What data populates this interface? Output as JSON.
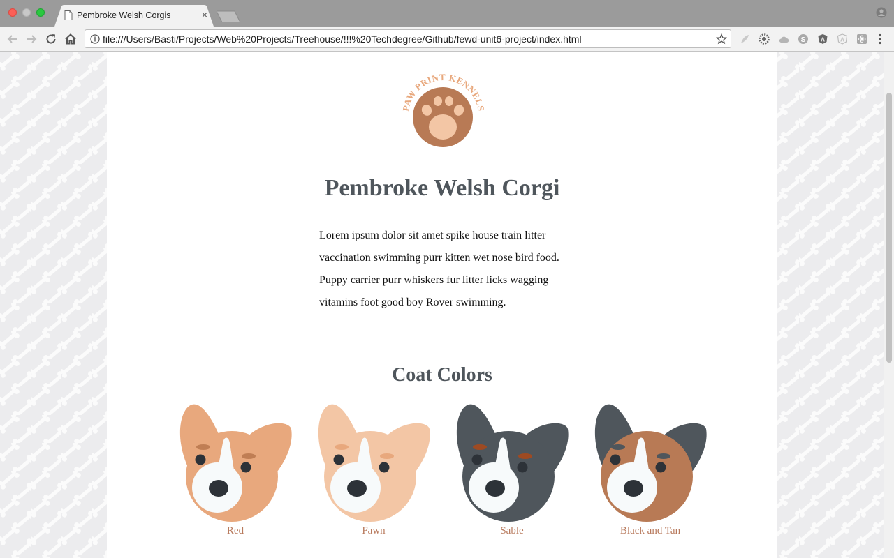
{
  "browser": {
    "tab_title": "Pembroke Welsh Corgis",
    "tab_close": "×",
    "url": "file:///Users/Basti/Projects/Web%20Projects/Treehouse/!!!%20Techdegree/Github/fewd-unit6-project/index.html"
  },
  "page": {
    "logo_text": "PAW PRINT KENNELS",
    "title": "Pembroke Welsh Corgi",
    "intro": "Lorem ipsum dolor sit amet spike house train litter vaccination swimming purr kitten wet nose bird food. Puppy carrier purr whiskers fur litter licks wagging vitamins foot good boy Rover swimming.",
    "coat_colors_heading": "Coat Colors",
    "coat_colors": [
      {
        "label": "Red",
        "primary": "#e8a87d",
        "ear_inner": "#e8a87d",
        "brow": "#c07e54"
      },
      {
        "label": "Fawn",
        "primary": "#f3c6a5",
        "ear_inner": "#f3c6a5",
        "brow": "#e8a87d"
      },
      {
        "label": "Sable",
        "primary": "#4f565c",
        "ear_inner": "#4f565c",
        "brow": "#9e4a22"
      },
      {
        "label": "Black and Tan",
        "primary": "#b87a55",
        "ear_inner": "#4f565c",
        "brow": "#4f565c"
      }
    ]
  },
  "colors": {
    "heading": "#4f565c",
    "caption": "#b87a5d",
    "logo_circle": "#b87a55",
    "logo_pad": "#f3c6a5",
    "logo_text": "#e8a87d"
  }
}
